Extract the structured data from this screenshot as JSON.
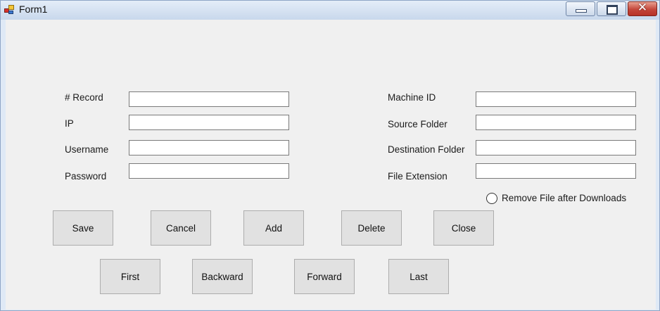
{
  "window": {
    "title": "Form1"
  },
  "title_controls": {
    "minimize": "minimize",
    "maximize": "maximize",
    "close": "close"
  },
  "fields_left": [
    {
      "label": "# Record",
      "value": ""
    },
    {
      "label": "IP",
      "value": ""
    },
    {
      "label": "Username",
      "value": ""
    },
    {
      "label": "Password",
      "value": ""
    }
  ],
  "fields_right": [
    {
      "label": "Machine ID",
      "value": ""
    },
    {
      "label": "Source Folder",
      "value": ""
    },
    {
      "label": "Destination Folder",
      "value": ""
    },
    {
      "label": "File Extension",
      "value": ""
    }
  ],
  "options": {
    "remove_file_label": "Remove File after Downloads",
    "remove_file_checked": false
  },
  "buttons_row1": {
    "save": "Save",
    "cancel": "Cancel",
    "add": "Add",
    "delete": "Delete",
    "close": "Close"
  },
  "buttons_row2": {
    "first": "First",
    "backward": "Backward",
    "forward": "Forward",
    "last": "Last"
  }
}
